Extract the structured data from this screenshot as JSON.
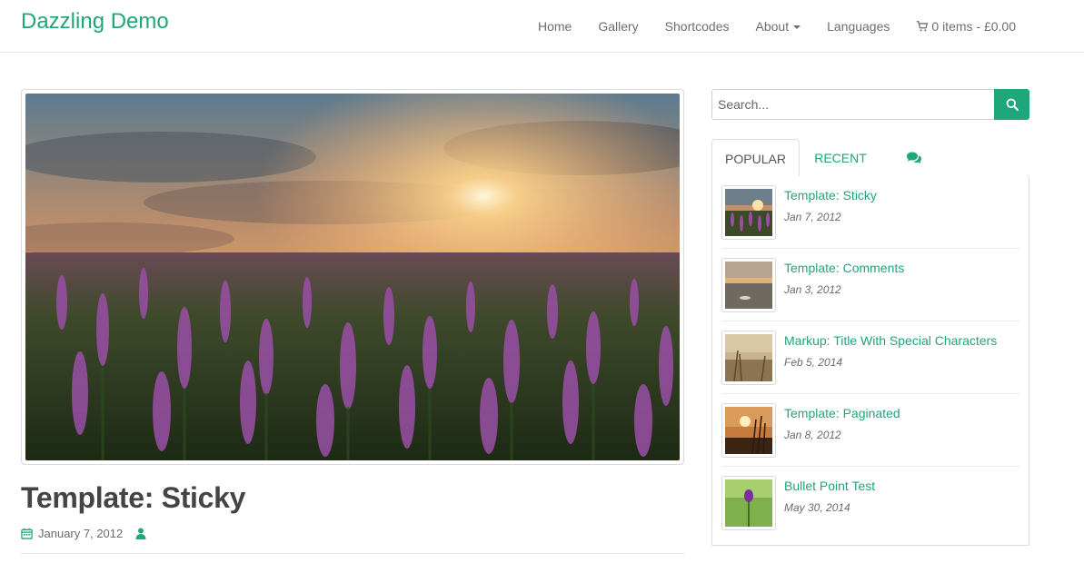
{
  "site": {
    "title": "Dazzling Demo"
  },
  "nav": {
    "items": [
      {
        "label": "Home"
      },
      {
        "label": "Gallery"
      },
      {
        "label": "Shortcodes"
      },
      {
        "label": "About"
      },
      {
        "label": "Languages"
      }
    ],
    "cart_label": "0 items - £0.00"
  },
  "post": {
    "title": "Template: Sticky",
    "date": "January 7, 2012"
  },
  "sidebar": {
    "search": {
      "placeholder": "Search..."
    },
    "tabs": [
      {
        "label": "POPULAR"
      },
      {
        "label": "RECENT"
      }
    ],
    "popular_posts": [
      {
        "title": "Template: Sticky",
        "date": "Jan 7, 2012"
      },
      {
        "title": "Template: Comments",
        "date": "Jan 3, 2012"
      },
      {
        "title": "Markup: Title With Special Characters",
        "date": "Feb 5, 2014"
      },
      {
        "title": "Template: Paginated",
        "date": "Jan 8, 2012"
      },
      {
        "title": "Bullet Point Test",
        "date": "May 30, 2014"
      }
    ]
  },
  "theme": {
    "accent": "#1fa67a",
    "text": "#6b6b6b",
    "heading": "#444444"
  }
}
